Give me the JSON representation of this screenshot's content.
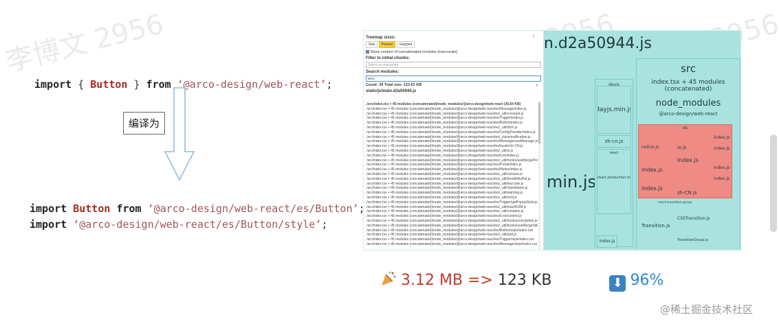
{
  "watermark": "李博文 2956",
  "code": {
    "line1": {
      "kw1": "import",
      "brace_open": " { ",
      "name": "Button",
      "brace_close": " } ",
      "kw2": "from",
      "str": " ‘@arco-design/web-react’",
      "end": ";"
    },
    "compile_label": "编译为",
    "line2": {
      "kw1": "import",
      "name": "Button",
      "kw2": "from",
      "str": " ‘@arco-design/web-react/es/Button’",
      "end": ";"
    },
    "line3": {
      "kw1": "import",
      "str": " ‘@arco-design/web-react/es/Button/style’",
      "end": ";"
    }
  },
  "treemap_panel": {
    "title": "Treemap sizes:",
    "size_options": [
      "Stat",
      "Parsed",
      "Gzipped"
    ],
    "selected_size": "Parsed",
    "show_contents_label": "Show content of concatenated modules (inaccurate)",
    "filter_label": "Filter to initial chunks:",
    "filter_placeholder": "Select an entrypoint",
    "search_label": "Search modules:",
    "search_value": "arco",
    "count_line": "Count: 39   Total size: 123.61 KB",
    "bundle_name": "static/js/main.d2a50944.js",
    "rows": [
      "./src/index.tsx + 45 modules (concatenated)/node_modules/@arco-design/web-react (30.64 KB)",
      "./src/index.tsx + 45 modules (concatenated)/node_modules/@arco-design/web-react/es/Message/index.js",
      "./src/index.tsx + 45 modules (concatenated)/node_modules/@arco-design/web-react/es/_util/constant.js",
      "./src/index.tsx + 45 modules (concatenated)/node_modules/@arco-design/web-react/es/Trigger/index.js",
      "./src/index.tsx + 45 modules (concatenated)/node_modules/@arco-design/web-react/es/Button/index.js",
      "./src/index.tsx + 45 modules (concatenated)/node_modules/@arco-design/web-react/es/_util/dom.js",
      "./src/index.tsx + 45 modules (concatenated)/node_modules/@arco-design/web-react/es/ConfigProvider/index.js",
      "./src/index.tsx + 45 modules (concatenated)/node_modules/@arco-design/web-react/es/_class/notification.js",
      "./src/index.tsx + 45 modules (concatenated)/node_modules/@arco-design/web-react/es/Message/useMessage.js",
      "./src/index.tsx + 45 modules (concatenated)/node_modules/@arco-design/web-react/es/locale/zh-CN.js",
      "./src/index.tsx + 45 modules (concatenated)/node_modules/@arco-design/web-react/es/_util/is.js",
      "./src/index.tsx + 45 modules (concatenated)/node_modules/@arco-design/web-react/es/Icon/index.js",
      "./src/index.tsx + 45 modules (concatenated)/node_modules/@arco-design/web-react/es/_util/hooks/useMergeProps.js",
      "./src/index.tsx + 45 modules (concatenated)/node_modules/@arco-design/web-react/es/Portal/index.js",
      "./src/index.tsx + 45 modules (concatenated)/node_modules/@arco-design/web-react/es/Notice/index.js",
      "./src/index.tsx + 45 modules (concatenated)/node_modules/@arco-design/web-react/es/_util/caniuse.js",
      "./src/index.tsx + 45 modules (concatenated)/node_modules/@arco-design/web-react/es/_util/throttleByRaf.js",
      "./src/index.tsx + 45 modules (concatenated)/node_modules/@arco-design/web-react/es/_util/keycode.js",
      "./src/index.tsx + 45 modules (concatenated)/node_modules/@arco-design/web-react/es/_util/className.js",
      "./src/index.tsx + 45 modules (concatenated)/node_modules/@arco-design/web-react/es/_util/warning.js",
      "./src/index.tsx + 45 modules (concatenated)/node_modules/@arco-design/web-react/es/_util/omit.js",
      "./src/index.tsx + 45 modules (concatenated)/node_modules/@arco-design/web-react/es/Trigger/getPopupStyle.js",
      "./src/index.tsx + 45 modules (concatenated)/node_modules/@arco-design/web-react/es/_util/reactDOM.js",
      "./src/index.tsx + 45 modules (concatenated)/node_modules/@arco-design/web-react/es/_util/contains.js",
      "./src/index.tsx + 45 modules (concatenated)/node_modules/@arco-design/web-react/es/Icon/context.js",
      "./src/index.tsx + 45 modules (concatenated)/node_modules/@arco-design/web-react/es/_util/hooks/useUpdate.js",
      "./src/index.tsx + 45 modules (concatenated)/node_modules/@arco-design/web-react/es/_util/hooks/useMergeValue.js",
      "./src/index.tsx + 45 modules (concatenated)/node_modules/@arco-design/web-react/es/Button/style/index.css",
      "./src/index.tsx + 45 modules (concatenated)/node_modules/@arco-design/web-react/es/_util/pad.js",
      "./src/index.tsx + 45 modules (concatenated)/node_modules/@arco-design/web-react/es/Trigger/style/index.css",
      "./src/index.tsx + 45 modules (concatenated)/node_modules/@arco-design/web-react/es/Message/style/index.css"
    ]
  },
  "treemap": {
    "bundle_label": "n.d2a50944.js",
    "big_label": "min.js",
    "dayjs_group": "dayjs",
    "dayjs_file": "dayjs.min.js",
    "zh_cn": "zh-cn.js",
    "react_label": "react",
    "react_prod": "react.production.min.js",
    "index_js": "index.js",
    "src": "src",
    "index_concat": "index.tsx + 45 modules\n(concatenated)",
    "node_modules": "node_modules",
    "arco": "@arco-design/web-react",
    "es": "es",
    "notice": "notice.js",
    "is": "is.js",
    "zh_cn_upper": "zh-CN.js",
    "react_transition": "react-transition-group",
    "transition": "Transition.js",
    "css_transition": "CSSTransition.js",
    "transition_group": "TransitionGroup.js"
  },
  "stats": {
    "before": "3.12 MB",
    "arrow": "=>",
    "after": "123 KB",
    "percent": "96%",
    "before_color": "#c0392b",
    "percent_color": "#2e86de"
  },
  "brand": "@稀土掘金技术社区"
}
